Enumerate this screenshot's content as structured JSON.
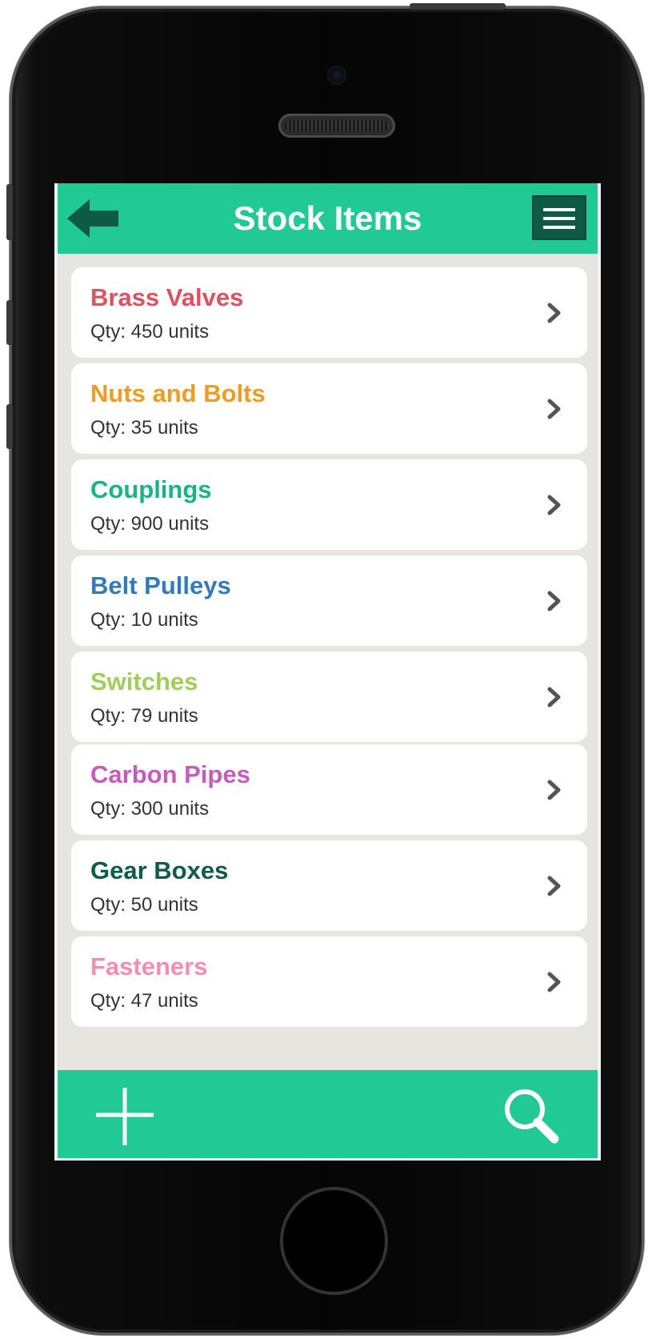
{
  "header": {
    "title": "Stock Items",
    "back_icon": "back-arrow-icon",
    "menu_icon": "hamburger-menu-icon"
  },
  "items": [
    {
      "name": "Brass Valves",
      "qty": "Qty: 450 units",
      "color": "#e0505f"
    },
    {
      "name": "Nuts and Bolts",
      "qty": "Qty: 35 units",
      "color": "#f39a21"
    },
    {
      "name": "Couplings",
      "qty": "Qty: 900 units",
      "color": "#17b487"
    },
    {
      "name": "Belt Pulleys",
      "qty": "Qty: 10 units",
      "color": "#2f7ac0"
    },
    {
      "name": "Switches",
      "qty": "Qty: 79 units",
      "color": "#9fce5a"
    },
    {
      "name": "Carbon Pipes",
      "qty": "Qty: 300 units",
      "color": "#c75bbd"
    },
    {
      "name": "Gear Boxes",
      "qty": "Qty: 50 units",
      "color": "#0d5e43"
    },
    {
      "name": "Fasteners",
      "qty": "Qty: 47 units",
      "color": "#f58db2"
    }
  ],
  "footer": {
    "add_icon": "plus-icon",
    "search_icon": "search-icon"
  },
  "colors": {
    "accent": "#21ca95",
    "accent_dark": "#0f5a44",
    "list_background": "#e6e5df"
  }
}
